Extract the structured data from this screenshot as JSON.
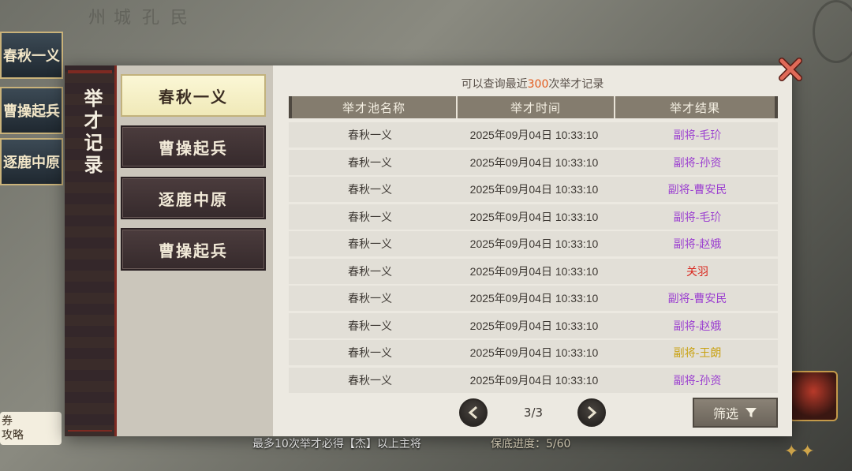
{
  "background": {
    "banners": [
      "春秋一义",
      "曹操起兵",
      "逐鹿中原"
    ],
    "vertical_texts": [
      "州",
      "城",
      "孔",
      "民"
    ],
    "bottom_hint": "最多10次举才必得【杰】以上主将",
    "progress_label": "保底进度：5/60",
    "coupon_line1": "券",
    "coupon_line2": "攻略"
  },
  "dialog": {
    "title": "举才记录",
    "notice_prefix": "可以查询最近",
    "notice_number": "300",
    "notice_suffix": "次举才记录",
    "close_icon": "close-x-icon",
    "tabs": [
      {
        "label": "春秋一义",
        "active": true
      },
      {
        "label": "曹操起兵",
        "active": false
      },
      {
        "label": "逐鹿中原",
        "active": false
      },
      {
        "label": "曹操起兵",
        "active": false
      }
    ],
    "table": {
      "headers": [
        "举才池名称",
        "举才时间",
        "举才结果"
      ],
      "rows": [
        {
          "pool": "春秋一义",
          "time": "2025年09月04日 10:33:10",
          "result": "副将-毛玠",
          "color": "#9b3fd0"
        },
        {
          "pool": "春秋一义",
          "time": "2025年09月04日 10:33:10",
          "result": "副将-孙资",
          "color": "#9b3fd0"
        },
        {
          "pool": "春秋一义",
          "time": "2025年09月04日 10:33:10",
          "result": "副将-曹安民",
          "color": "#9b3fd0"
        },
        {
          "pool": "春秋一义",
          "time": "2025年09月04日 10:33:10",
          "result": "副将-毛玠",
          "color": "#9b3fd0"
        },
        {
          "pool": "春秋一义",
          "time": "2025年09月04日 10:33:10",
          "result": "副将-赵娥",
          "color": "#9b3fd0"
        },
        {
          "pool": "春秋一义",
          "time": "2025年09月04日 10:33:10",
          "result": "关羽",
          "color": "#d9281f"
        },
        {
          "pool": "春秋一义",
          "time": "2025年09月04日 10:33:10",
          "result": "副将-曹安民",
          "color": "#9b3fd0"
        },
        {
          "pool": "春秋一义",
          "time": "2025年09月04日 10:33:10",
          "result": "副将-赵娥",
          "color": "#9b3fd0"
        },
        {
          "pool": "春秋一义",
          "time": "2025年09月04日 10:33:10",
          "result": "副将-王朗",
          "color": "#c9a213"
        },
        {
          "pool": "春秋一义",
          "time": "2025年09月04日 10:33:10",
          "result": "副将-孙资",
          "color": "#9b3fd0"
        }
      ]
    },
    "pagination": {
      "indicator": "3/3",
      "prev_icon": "chevron-left-icon",
      "next_icon": "chevron-right-icon"
    },
    "filter": {
      "label": "筛选",
      "icon": "funnel-icon"
    }
  }
}
